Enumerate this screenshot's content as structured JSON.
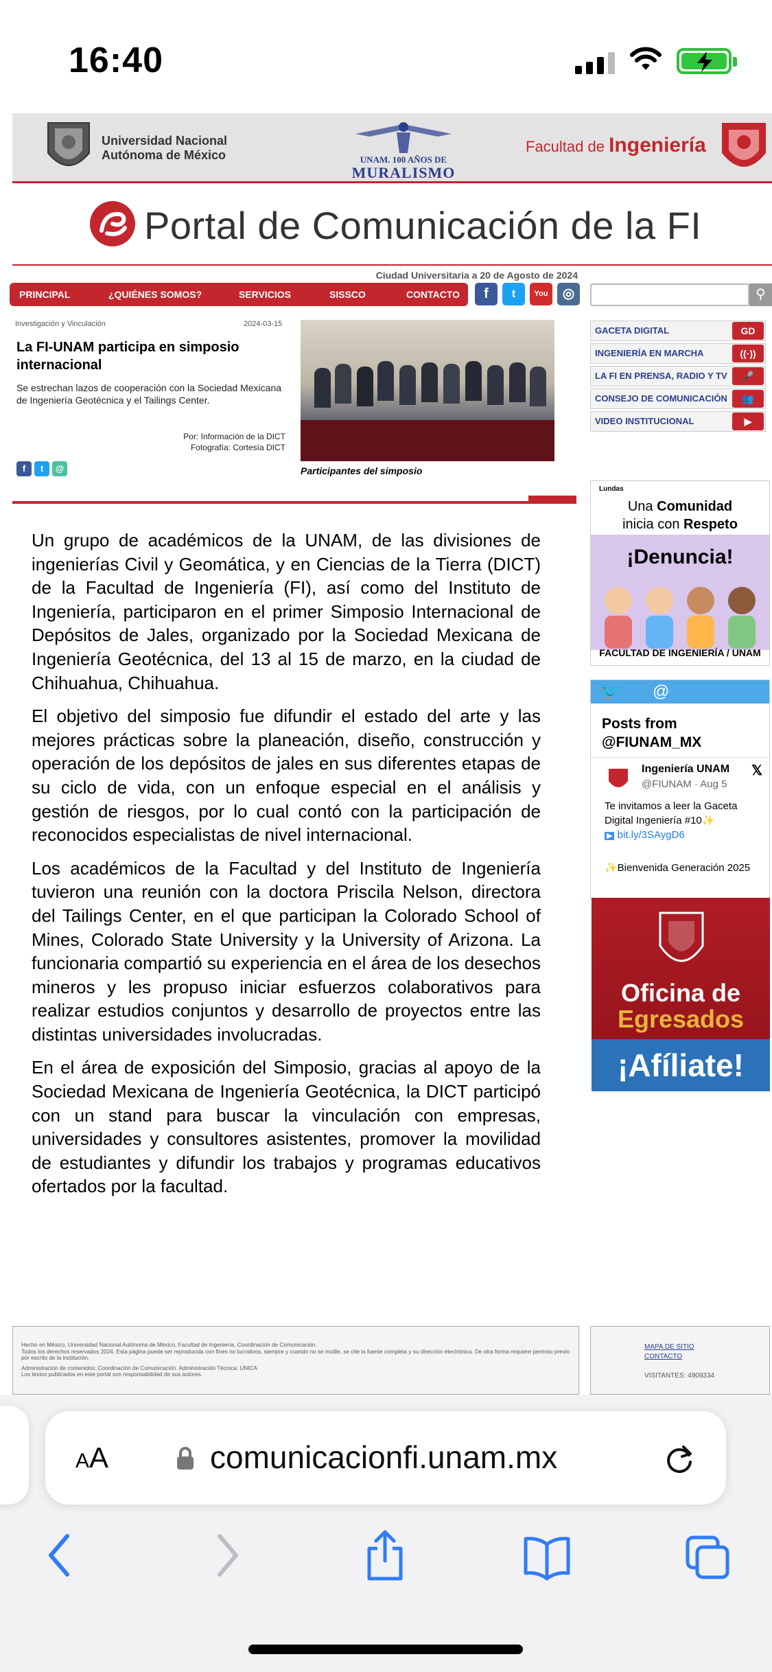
{
  "status_bar": {
    "time": "16:40"
  },
  "banner": {
    "unam_line1": "Universidad Nacional",
    "unam_line2": "Autónoma de México",
    "mural_line1": "UNAM. 100 AÑOS DE",
    "mural_line2": "MURALISMO",
    "fi_prefix": "Facultad de",
    "fi_name": "Ingeniería"
  },
  "portal_title": "Portal de Comunicación de la FI",
  "date_line": "Ciudad Universitaria a 20 de Agosto de 2024",
  "nav": {
    "items": [
      "PRINCIPAL",
      "¿QUIÉNES SOMOS?",
      "SERVICIOS",
      "SISSCO",
      "CONTACTO"
    ]
  },
  "social": {
    "facebook": "f",
    "twitter": "t",
    "youtube": "You",
    "instagram": "◎"
  },
  "article": {
    "category": "Investigación y Vinculación",
    "date": "2024-03-15",
    "headline": "La FI-UNAM participa en simposio internacional",
    "subhead": "Se estrechan lazos de cooperación con la Sociedad Mexicana de Ingeniería Geotécnica y el Tailings Center.",
    "byline1": "Por: Información de la DICT",
    "byline2": "Fotografía: Cortesía DICT",
    "photo_caption": "Participantes del simposio",
    "paragraphs": [
      "Un grupo de académicos de la UNAM, de las divisiones de ingenierías Civil y Geomática, y en Ciencias de la Tierra (DICT) de la Facultad de Ingeniería (FI), así como del Instituto de Ingeniería, participaron en el primer Simposio Internacional de Depósitos de Jales, organizado por la Sociedad Mexicana de Ingeniería Geotécnica, del 13 al 15 de marzo, en la ciudad de Chihuahua, Chihuahua.",
      "El objetivo del simposio fue difundir el estado del arte y las mejores prácticas sobre la planeación, diseño, construcción y operación de los depósitos de jales en sus diferentes etapas de su ciclo de vida, con un enfoque especial en el análisis y gestión de riesgos, por lo cual contó con la participación de reconocidos especialistas de nivel internacional.",
      "Los académicos de la Facultad y del Instituto de Ingeniería tuvieron una reunión con la doctora Priscila Nelson, directora del Tailings Center, en el que participan la Colorado School of Mines, Colorado State University y la University of Arizona. La funcionaria compartió su experiencia en el área de los desechos mineros y les propuso iniciar esfuerzos colaborativos para realizar estudios conjuntos y desarrollo de proyectos entre las distintas universidades involucradas.",
      "En el área de exposición del Simposio, gracias al apoyo de la Sociedad Mexicana de Ingeniería Geotécnica, la DICT participó con un stand para buscar la vinculación con empresas, universidades y consultores asistentes, promover la movilidad de estudiantes y difundir los trabajos y programas educativos ofertados por la facultad."
    ]
  },
  "sidebar": {
    "links": [
      "GACETA DIGITAL",
      "INGENIERÍA EN MARCHA",
      "LA FI EN PRENSA, RADIO Y TV",
      "CONSEJO DE COMUNICACIÓN",
      "VIDEO INSTITUCIONAL"
    ],
    "link_icons": [
      "GD",
      "((·))",
      "🎤",
      "👥",
      "▶"
    ],
    "lundas": {
      "brand": "Lundas",
      "line1_a": "Una",
      "line1_b": "Comunidad",
      "line2_a": "inicia con",
      "line2_b": "Respeto",
      "denuncia": "¡Denuncia!",
      "footer": "FACULTAD DE INGENIERÍA / UNAM"
    },
    "twitter": {
      "header": "@ FIUNAM_MX",
      "title": "Posts from @FIUNAM_MX",
      "author": "Ingeniería UNAM",
      "handle": "@FIUNAM · Aug 5",
      "text": "Te invitamos a leer la Gaceta Digital Ingeniería #10✨",
      "link": "bit.ly/3SAygD6",
      "text2": "✨Bienvenida Generación 2025"
    },
    "egresados": {
      "line1": "Oficina de",
      "line2": "Egresados",
      "cta": "¡Afíliate!"
    }
  },
  "footer": {
    "line1": "Hecho en México, Universidad Nacional Autónoma de México, Facultad de Ingeniería, Coordinación de Comunicación.",
    "line2": "Todos los derechos reservados 2024. Esta página puede ser reproducida con fines no lucrativos, siempre y cuando no se mutile, se cite la fuente completa y su dirección electrónica. De otra forma requiere permiso previo por escrito de la institución.",
    "line3": "Administración de contenidos: Coordinación de Comunicación. Administración Técnica: UNICA",
    "line4": "Los textos publicados en este portal son responsabilidad de sus autores.",
    "sitemap": "MAPA DE SITIO",
    "contact": "CONTACTO",
    "visitors": "VISITANTES: 4909334"
  },
  "browser": {
    "aa": "AA",
    "url": "comunicacionfi.unam.mx"
  },
  "colors": {
    "brand_red": "#c4262e",
    "brand_blue": "#2a3f8e",
    "twitter_blue": "#4fa8e8",
    "ios_blue": "#2f7cf6"
  }
}
